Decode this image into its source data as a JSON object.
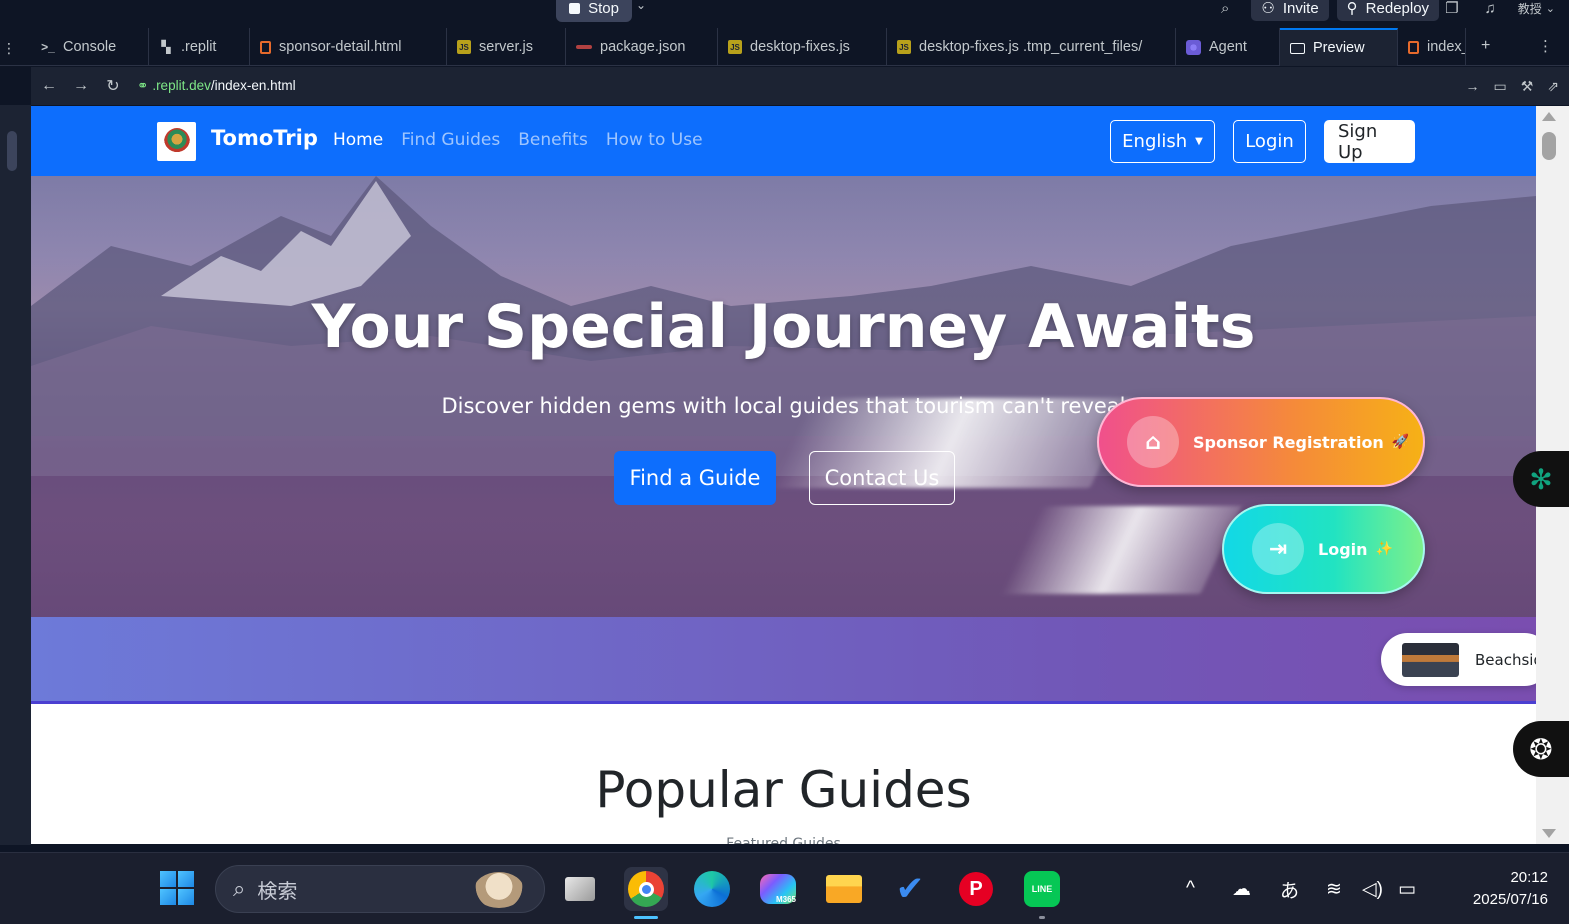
{
  "replit": {
    "stop_label": "Stop",
    "invite_label": "Invite",
    "redeploy_label": "Redeploy",
    "avatar_label": "教授",
    "tabs": [
      {
        "label": "Console",
        "icon": "terminal-icon"
      },
      {
        "label": ".replit",
        "icon": "replit-config-icon"
      },
      {
        "label": "sponsor-detail.html",
        "icon": "html-file-icon"
      },
      {
        "label": "server.js",
        "icon": "js-file-icon"
      },
      {
        "label": "package.json",
        "icon": "json-file-icon"
      },
      {
        "label": "desktop-fixes.js",
        "icon": "js-file-icon"
      },
      {
        "label": "desktop-fixes.js .tmp_current_files/",
        "icon": "js-file-icon"
      },
      {
        "label": "Agent",
        "icon": "agent-icon"
      },
      {
        "label": "Preview",
        "icon": "preview-icon"
      },
      {
        "label": "index_",
        "icon": "html-file-icon"
      }
    ],
    "url_host": ".replit.dev",
    "url_path": "/index-en.html"
  },
  "site": {
    "brand": "TomoTrip",
    "nav": [
      "Home",
      "Find Guides",
      "Benefits",
      "How to Use"
    ],
    "language": "English",
    "login": "Login",
    "signup": "Sign Up",
    "hero_title": "Your Special Journey Awaits",
    "hero_subtitle": "Discover hidden gems with local guides that tourism can't reveal",
    "find_guide": "Find a Guide",
    "contact_us": "Contact Us",
    "sponsor_registration": "Sponsor Registration",
    "sponsor_emoji": "🚀",
    "floating_login": "Login",
    "floating_login_emoji": "✨",
    "ticker_text": "Beachsid",
    "popular_title": "Popular Guides",
    "popular_subtitle": "Featured Guides"
  },
  "taskbar": {
    "search_placeholder": "検索",
    "ime": "あ",
    "time": "20:12",
    "date": "2025/07/16",
    "apps": [
      "task-view",
      "chrome",
      "edge",
      "m365",
      "file-explorer",
      "todo",
      "pinterest",
      "line"
    ],
    "m365_label": "M365",
    "line_label": "LINE"
  },
  "colors": {
    "navbar": "#0d6efd",
    "sponsor_gradient": [
      "#f0508c",
      "#f6b116"
    ],
    "login_gradient": [
      "#12d8e6",
      "#7df08a"
    ],
    "band": "#7157b7"
  }
}
